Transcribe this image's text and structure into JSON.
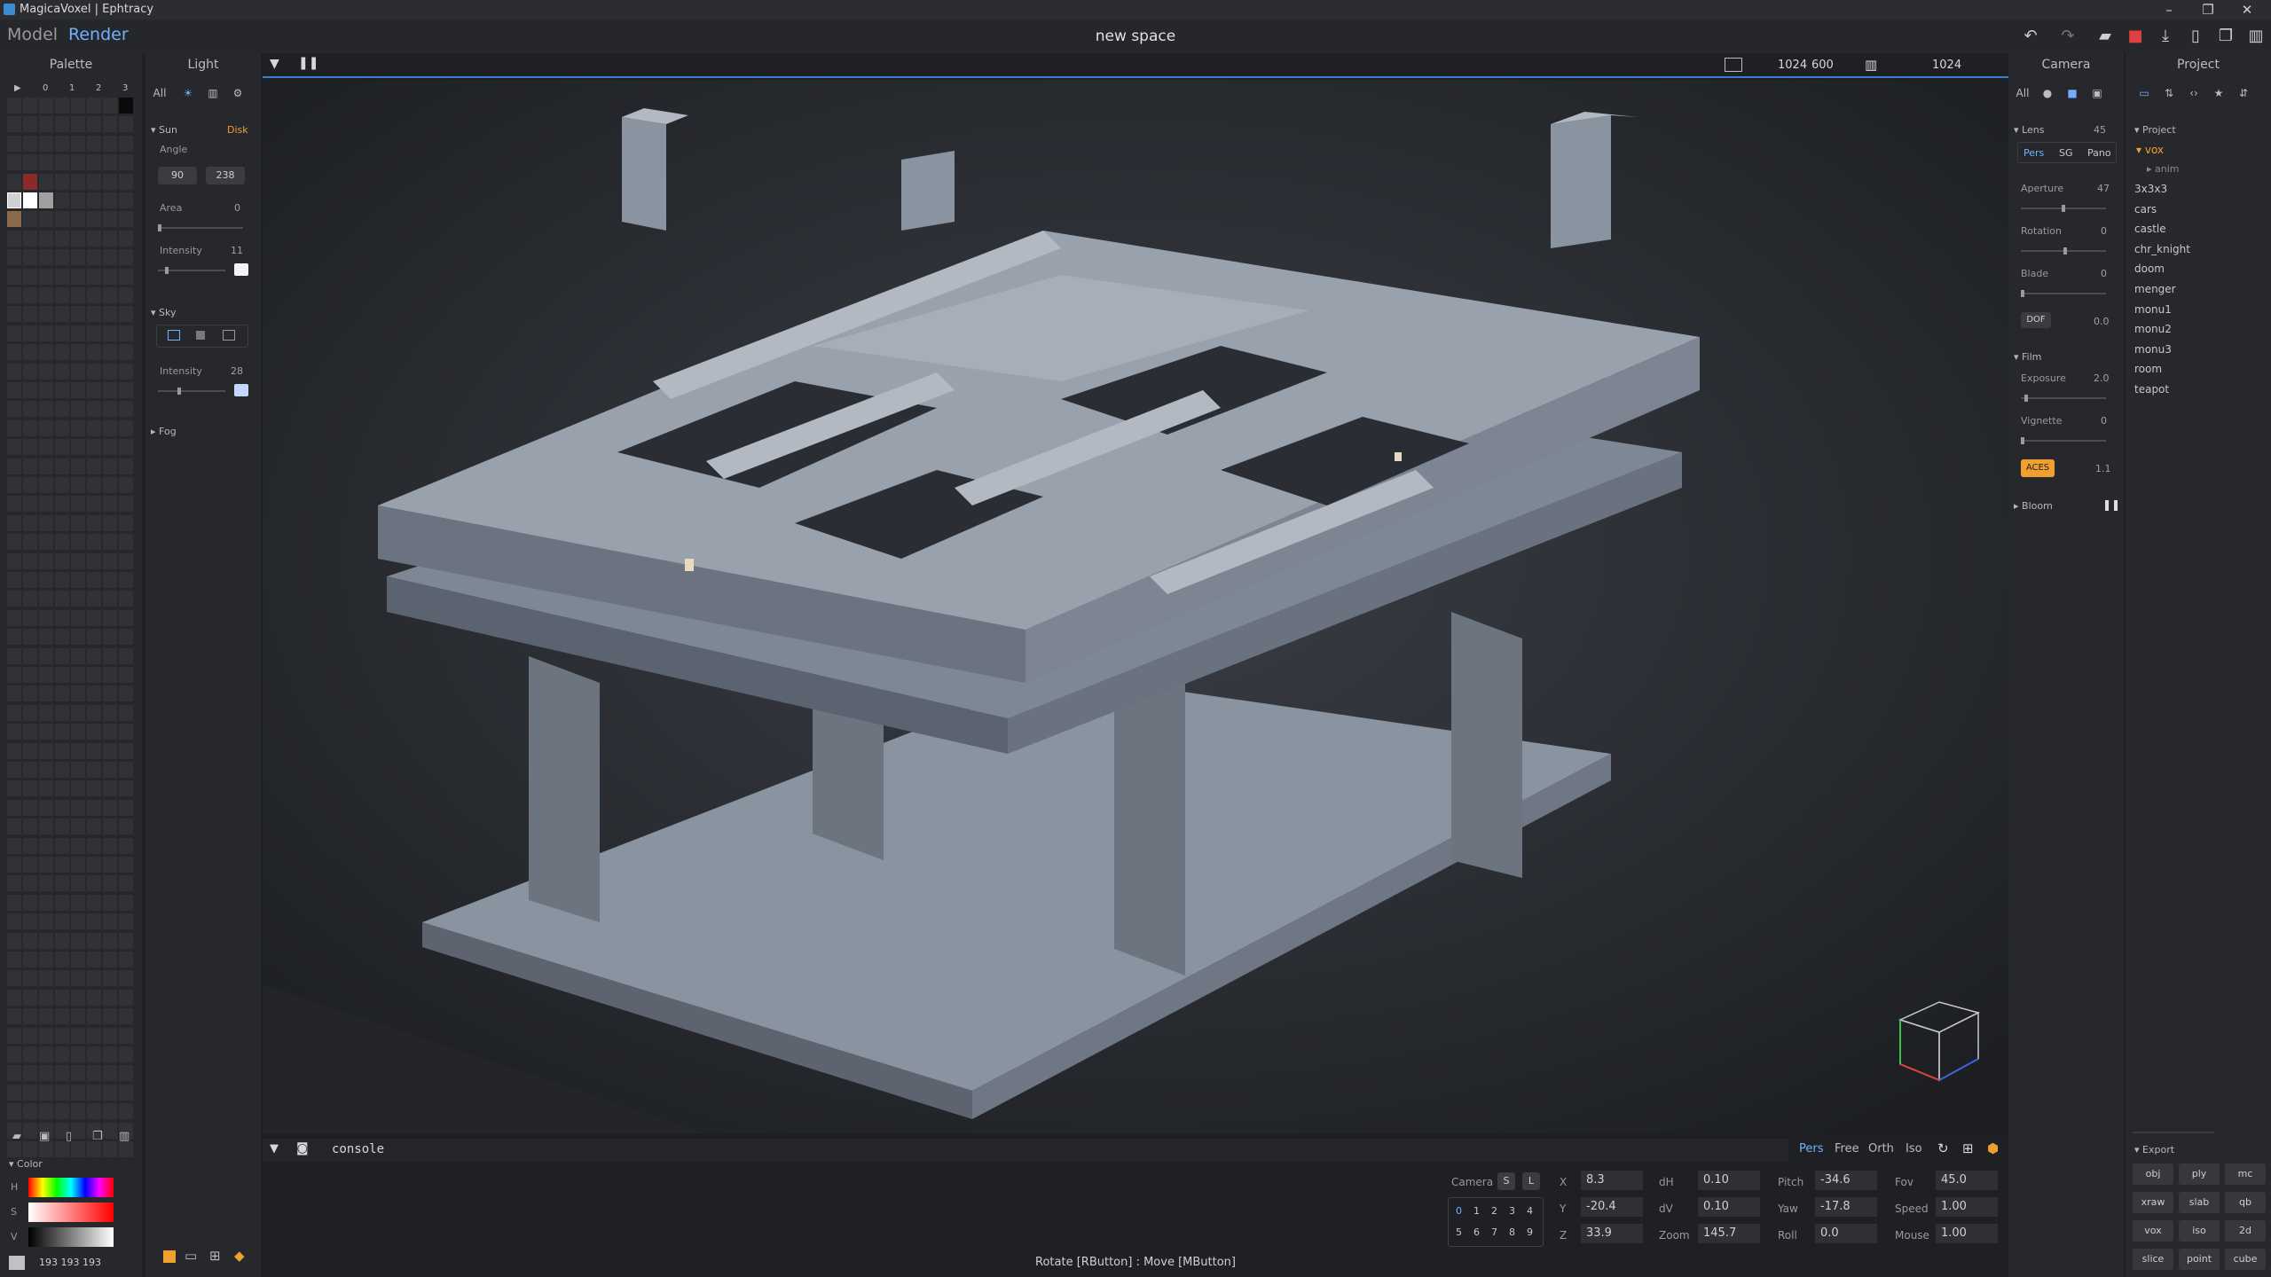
{
  "window": {
    "title": "MagicaVoxel | Ephtracy"
  },
  "menu": {
    "model": "Model",
    "render": "Render"
  },
  "document": {
    "title": "new space"
  },
  "palette": {
    "title": "Palette",
    "columns": [
      "0",
      "1",
      "2",
      "3"
    ]
  },
  "color": {
    "title": "Color",
    "h": "H",
    "s": "S",
    "v": "V",
    "rgb": "193  193  193"
  },
  "light": {
    "title": "Light",
    "tab_all": "All",
    "sun": "Sun",
    "disk": "Disk",
    "angle": "Angle",
    "angle_a": "90",
    "angle_b": "238",
    "area": "Area",
    "area_val": "0",
    "intensity": "Intensity",
    "intensity_val": "11",
    "sky": "Sky",
    "sky_intensity": "Intensity",
    "sky_intensity_val": "28",
    "fog": "Fog"
  },
  "viewport": {
    "res_w": "1024",
    "res_h": "600",
    "samples": "1024",
    "console": "console",
    "hint": "Rotate [RButton] : Move [MButton]",
    "modes": [
      "Pers",
      "Free",
      "Orth",
      "Iso"
    ]
  },
  "camera_bar": {
    "label": "Camera",
    "s": "S",
    "l": "L",
    "slots": [
      "0",
      "1",
      "2",
      "3",
      "4",
      "5",
      "6",
      "7",
      "8",
      "9"
    ],
    "x_lbl": "X",
    "x": "8.3",
    "y_lbl": "Y",
    "y": "-20.4",
    "z_lbl": "Z",
    "z": "33.9",
    "dh_lbl": "dH",
    "dh": "0.10",
    "dv_lbl": "dV",
    "dv": "0.10",
    "zoom_lbl": "Zoom",
    "zoom": "145.7",
    "pitch_lbl": "Pitch",
    "pitch": "-34.6",
    "yaw_lbl": "Yaw",
    "yaw": "-17.8",
    "roll_lbl": "Roll",
    "roll": "0.0",
    "fov_lbl": "Fov",
    "fov": "45.0",
    "speed_lbl": "Speed",
    "speed": "1.00",
    "mouse_lbl": "Mouse",
    "mouse": "1.00"
  },
  "camera": {
    "title": "Camera",
    "tab_all": "All",
    "lens": "Lens",
    "lens_val": "45",
    "pers": "Pers",
    "sg": "SG",
    "pano": "Pano",
    "aperture": "Aperture",
    "aperture_val": "47",
    "rotation": "Rotation",
    "rotation_val": "0",
    "blade": "Blade",
    "blade_val": "0",
    "dof": "DOF",
    "dof_val": "0.0",
    "film": "Film",
    "exposure": "Exposure",
    "exposure_val": "2.0",
    "vignette": "Vignette",
    "vignette_val": "0",
    "aces": "ACES",
    "aces_val": "1.1",
    "bloom": "Bloom"
  },
  "project": {
    "title": "Project",
    "section": "Project",
    "folder": "vox",
    "sub": "anim",
    "items": [
      "3x3x3",
      "cars",
      "castle",
      "chr_knight",
      "doom",
      "menger",
      "monu1",
      "monu2",
      "monu3",
      "room",
      "teapot"
    ]
  },
  "export": {
    "title": "Export",
    "buttons": [
      "obj",
      "ply",
      "mc",
      "xraw",
      "slab",
      "qb",
      "vox",
      "iso",
      "2d",
      "slice",
      "point",
      "cube"
    ]
  },
  "colors": {
    "accent": "#3a7bd5",
    "aces": "#f0a030",
    "voxel": "#8e96a3"
  }
}
